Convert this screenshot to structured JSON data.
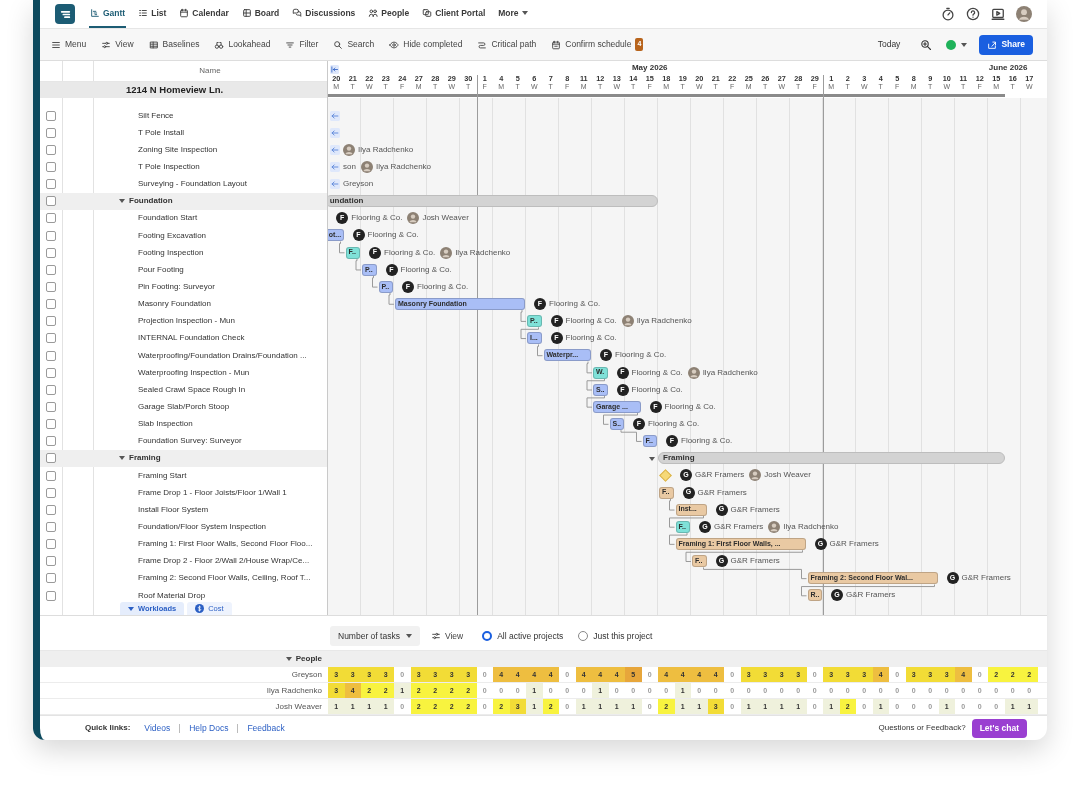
{
  "nav_tabs": [
    {
      "label": "Gantt",
      "selected": true
    },
    {
      "label": "List",
      "selected": false
    },
    {
      "label": "Calendar",
      "selected": false
    },
    {
      "label": "Board",
      "selected": false
    },
    {
      "label": "Discussions",
      "selected": false
    },
    {
      "label": "People",
      "selected": false
    },
    {
      "label": "Client Portal",
      "selected": false
    },
    {
      "label": "More",
      "selected": false
    }
  ],
  "toolbar": [
    {
      "label": "Menu"
    },
    {
      "label": "View"
    },
    {
      "label": "Baselines"
    },
    {
      "label": "Lookahead"
    },
    {
      "label": "Filter"
    },
    {
      "label": "Search"
    },
    {
      "label": "Hide completed"
    },
    {
      "label": "Critical path"
    },
    {
      "label": "Confirm schedule",
      "badge": "4"
    }
  ],
  "toolbar_right": {
    "today": "Today",
    "status": {
      "color": "#1fb25a"
    },
    "share": "Share"
  },
  "list_header": "Name",
  "project": "1214 N Homeview Ln.",
  "timeline": {
    "months": [
      {
        "days": [
          {
            "date": "20",
            "weekday": "M"
          },
          {
            "date": "21",
            "weekday": "T"
          },
          {
            "date": "22",
            "weekday": "W"
          },
          {
            "date": "23",
            "weekday": "T"
          },
          {
            "date": "24",
            "weekday": "F"
          },
          {
            "date": "27",
            "weekday": "M"
          },
          {
            "date": "28",
            "weekday": "T"
          },
          {
            "date": "29",
            "weekday": "W"
          },
          {
            "date": "30",
            "weekday": "T"
          }
        ]
      },
      {
        "label": "May 2026",
        "days": [
          {
            "date": "1",
            "weekday": "F"
          },
          {
            "date": "4",
            "weekday": "M"
          },
          {
            "date": "5",
            "weekday": "T"
          },
          {
            "date": "6",
            "weekday": "W"
          },
          {
            "date": "7",
            "weekday": "T"
          },
          {
            "date": "8",
            "weekday": "F"
          },
          {
            "date": "11",
            "weekday": "M"
          },
          {
            "date": "12",
            "weekday": "T"
          },
          {
            "date": "13",
            "weekday": "W"
          },
          {
            "date": "14",
            "weekday": "T"
          },
          {
            "date": "15",
            "weekday": "F"
          },
          {
            "date": "18",
            "weekday": "M"
          },
          {
            "date": "19",
            "weekday": "T"
          },
          {
            "date": "20",
            "weekday": "W"
          },
          {
            "date": "21",
            "weekday": "T"
          },
          {
            "date": "22",
            "weekday": "F"
          },
          {
            "date": "25",
            "weekday": "M"
          },
          {
            "date": "26",
            "weekday": "T"
          },
          {
            "date": "27",
            "weekday": "W"
          },
          {
            "date": "28",
            "weekday": "T"
          },
          {
            "date": "29",
            "weekday": "F"
          }
        ]
      },
      {
        "label": "June 2026",
        "days": [
          {
            "date": "1",
            "weekday": "M"
          },
          {
            "date": "2",
            "weekday": "T"
          },
          {
            "date": "3",
            "weekday": "W"
          },
          {
            "date": "4",
            "weekday": "T"
          },
          {
            "date": "5",
            "weekday": "F"
          },
          {
            "date": "8",
            "weekday": "M"
          },
          {
            "date": "9",
            "weekday": "T"
          },
          {
            "date": "10",
            "weekday": "W"
          },
          {
            "date": "11",
            "weekday": "T"
          },
          {
            "date": "12",
            "weekday": "F"
          },
          {
            "date": "15",
            "weekday": "M"
          },
          {
            "date": "16",
            "weekday": "T"
          },
          {
            "date": "17",
            "weekday": "W"
          }
        ]
      }
    ]
  },
  "tasks": [
    {
      "kind": "task",
      "name": "Silt Fence",
      "checked": false,
      "offscreen": true
    },
    {
      "kind": "task",
      "name": "T Pole Install",
      "checked": false,
      "offscreen": true
    },
    {
      "kind": "task",
      "name": "Zoning Site Inspection",
      "checked": false,
      "offscreen": true,
      "assignees": [
        {
          "kind": "person",
          "name": "Ilya Radchenko"
        }
      ]
    },
    {
      "kind": "task",
      "name": "T Pole Inspection",
      "checked": false,
      "offscreen": true,
      "assignees": [
        {
          "kind": "plain",
          "name": "son"
        },
        {
          "kind": "person",
          "name": "Ilya Radchenko"
        }
      ]
    },
    {
      "kind": "task",
      "name": "Surveying - Foundation Layout",
      "checked": false,
      "offscreen": true,
      "assignees": [
        {
          "kind": "plain",
          "name": "Greyson"
        }
      ]
    },
    {
      "kind": "group",
      "name": "Foundation",
      "checked": false,
      "expanded": true,
      "offscreen": false,
      "bar": {
        "kind": "group",
        "label": "undation"
      }
    },
    {
      "kind": "task",
      "name": "Foundation Start",
      "checked": false,
      "offscreen": false,
      "assignees": [
        {
          "kind": "company",
          "initial": "F",
          "name": "Flooring & Co."
        },
        {
          "kind": "person",
          "name": "Josh Weaver"
        }
      ]
    },
    {
      "kind": "task",
      "name": "Footing Excavation",
      "checked": false,
      "offscreen": false,
      "bar": {
        "kind": "bar",
        "label": "ot...",
        "color": "#a9bef6"
      },
      "assignees": [
        {
          "kind": "company",
          "initial": "F",
          "name": "Flooring & Co."
        }
      ]
    },
    {
      "kind": "task",
      "name": "Footing Inspection",
      "checked": false,
      "offscreen": false,
      "bar": {
        "kind": "bar",
        "label": "F..",
        "color": "#7fe1d8"
      },
      "assignees": [
        {
          "kind": "company",
          "initial": "F",
          "name": "Flooring & Co."
        },
        {
          "kind": "person",
          "name": "Ilya Radchenko"
        }
      ]
    },
    {
      "kind": "task",
      "name": "Pour Footing",
      "checked": false,
      "offscreen": false,
      "bar": {
        "kind": "bar",
        "label": "P..",
        "color": "#a9bef6"
      },
      "assignees": [
        {
          "kind": "company",
          "initial": "F",
          "name": "Flooring & Co."
        }
      ]
    },
    {
      "kind": "task",
      "name": "Pin Footing: Surveyor",
      "checked": false,
      "offscreen": false,
      "bar": {
        "kind": "bar",
        "label": "P..",
        "color": "#a9bef6"
      },
      "assignees": [
        {
          "kind": "company",
          "initial": "F",
          "name": "Flooring & Co."
        }
      ]
    },
    {
      "kind": "task",
      "name": "Masonry Foundation",
      "checked": false,
      "offscreen": false,
      "bar": {
        "kind": "bar",
        "label": "Masonry Foundation",
        "color": "#a9bef6"
      },
      "assignees": [
        {
          "kind": "company",
          "initial": "F",
          "name": "Flooring & Co."
        }
      ]
    },
    {
      "kind": "task",
      "name": "Projection Inspection - Mun",
      "checked": false,
      "offscreen": false,
      "bar": {
        "kind": "bar",
        "label": "P..",
        "color": "#7fe1d8"
      },
      "assignees": [
        {
          "kind": "company",
          "initial": "F",
          "name": "Flooring & Co."
        },
        {
          "kind": "person",
          "name": "Ilya Radchenko"
        }
      ]
    },
    {
      "kind": "task",
      "name": "INTERNAL Foundation Check",
      "checked": false,
      "offscreen": false,
      "bar": {
        "kind": "bar",
        "label": "I...",
        "color": "#a9bef6"
      },
      "assignees": [
        {
          "kind": "company",
          "initial": "F",
          "name": "Flooring & Co."
        }
      ]
    },
    {
      "kind": "task",
      "name": "Waterproofing/Foundation Drains/Foundation ...",
      "checked": false,
      "offscreen": false,
      "bar": {
        "kind": "bar",
        "label": "Waterpr...",
        "color": "#a9bef6"
      },
      "assignees": [
        {
          "kind": "company",
          "initial": "F",
          "name": "Flooring & Co."
        }
      ]
    },
    {
      "kind": "task",
      "name": "Waterproofing Inspection - Mun",
      "checked": false,
      "offscreen": false,
      "bar": {
        "kind": "bar",
        "label": "W.",
        "color": "#7fe1d8"
      },
      "assignees": [
        {
          "kind": "company",
          "initial": "F",
          "name": "Flooring & Co."
        },
        {
          "kind": "person",
          "name": "Ilya Radchenko"
        }
      ]
    },
    {
      "kind": "task",
      "name": "Sealed Crawl Space Rough In",
      "checked": false,
      "offscreen": false,
      "bar": {
        "kind": "bar",
        "label": "S..",
        "color": "#a9bef6"
      },
      "assignees": [
        {
          "kind": "company",
          "initial": "F",
          "name": "Flooring & Co."
        }
      ]
    },
    {
      "kind": "task",
      "name": "Garage Slab/Porch Stoop",
      "checked": false,
      "offscreen": false,
      "bar": {
        "kind": "bar",
        "label": "Garage ...",
        "color": "#a9bef6"
      },
      "assignees": [
        {
          "kind": "company",
          "initial": "F",
          "name": "Flooring & Co."
        }
      ]
    },
    {
      "kind": "task",
      "name": "Slab Inspection",
      "checked": false,
      "offscreen": false,
      "bar": {
        "kind": "bar",
        "label": "S..",
        "color": "#a9bef6"
      },
      "assignees": [
        {
          "kind": "company",
          "initial": "F",
          "name": "Flooring & Co."
        }
      ]
    },
    {
      "kind": "task",
      "name": "Foundation Survey: Surveyor",
      "checked": false,
      "offscreen": false,
      "bar": {
        "kind": "bar",
        "label": "F..",
        "color": "#a9bef6"
      },
      "assignees": [
        {
          "kind": "company",
          "initial": "F",
          "name": "Flooring & Co."
        }
      ]
    },
    {
      "kind": "group",
      "name": "Framing",
      "checked": false,
      "expanded": true,
      "offscreen": false,
      "bar": {
        "kind": "group",
        "label": "Framing"
      }
    },
    {
      "kind": "task",
      "name": "Framing Start",
      "checked": false,
      "offscreen": false,
      "bar": {
        "kind": "milestone"
      },
      "assignees": [
        {
          "kind": "company",
          "initial": "G",
          "name": "G&R Framers"
        },
        {
          "kind": "person",
          "name": "Josh Weaver"
        }
      ]
    },
    {
      "kind": "task",
      "name": "Frame Drop 1 - Floor Joists/Floor 1/Wall 1",
      "checked": false,
      "offscreen": false,
      "bar": {
        "kind": "bar",
        "label": "F..",
        "color": "#e9c9a3"
      },
      "assignees": [
        {
          "kind": "company",
          "initial": "G",
          "name": "G&R Framers"
        }
      ]
    },
    {
      "kind": "task",
      "name": "Install Floor System",
      "checked": false,
      "offscreen": false,
      "bar": {
        "kind": "bar",
        "label": "Inst...",
        "color": "#e9c9a3"
      },
      "assignees": [
        {
          "kind": "company",
          "initial": "G",
          "name": "G&R Framers"
        }
      ]
    },
    {
      "kind": "task",
      "name": "Foundation/Floor System Inspection",
      "checked": false,
      "offscreen": false,
      "bar": {
        "kind": "bar",
        "label": "F..",
        "color": "#7fe1d8"
      },
      "assignees": [
        {
          "kind": "company",
          "initial": "G",
          "name": "G&R Framers"
        },
        {
          "kind": "person",
          "name": "Ilya Radchenko"
        }
      ]
    },
    {
      "kind": "task",
      "name": "Framing 1: First Floor Walls, Second Floor Floo...",
      "checked": false,
      "offscreen": false,
      "bar": {
        "kind": "bar",
        "label": "Framing 1: First Floor Walls, ...",
        "color": "#e9c9a3"
      },
      "assignees": [
        {
          "kind": "company",
          "initial": "G",
          "name": "G&R Framers"
        }
      ]
    },
    {
      "kind": "task",
      "name": "Frame Drop 2 - Floor 2/Wall 2/House Wrap/Ce...",
      "checked": false,
      "offscreen": false,
      "bar": {
        "kind": "bar",
        "label": "F..",
        "color": "#e9c9a3"
      },
      "assignees": [
        {
          "kind": "company",
          "initial": "G",
          "name": "G&R Framers"
        }
      ]
    },
    {
      "kind": "task",
      "name": "Framing 2: Second Floor Walls, Ceiling, Roof T...",
      "checked": false,
      "offscreen": false,
      "bar": {
        "kind": "bar",
        "label": "Framing 2: Second Floor Wal...",
        "color": "#e9c9a3"
      },
      "assignees": [
        {
          "kind": "company",
          "initial": "G",
          "name": "G&R Framers"
        }
      ]
    },
    {
      "kind": "task",
      "name": "Roof Material Drop",
      "checked": false,
      "offscreen": false,
      "bar": {
        "kind": "bar",
        "label": "R..",
        "color": "#e9c9a3"
      },
      "assignees": [
        {
          "kind": "company",
          "initial": "G",
          "name": "G&R Framers"
        }
      ]
    }
  ],
  "workload": {
    "tabs": [
      {
        "label": "Workloads",
        "selected": true
      },
      {
        "label": "Cost",
        "selected": false
      }
    ],
    "metric": "Number of tasks",
    "view": "View",
    "scope": [
      {
        "label": "All active projects",
        "selected": true
      },
      {
        "label": "Just this project",
        "selected": false
      }
    ],
    "group": {
      "label": "People",
      "expanded": true
    },
    "rows": [
      {
        "name": "Greyson",
        "cells": [
          "3",
          "3",
          "3",
          "3",
          "0",
          "3",
          "3",
          "3",
          "3",
          "0",
          "4",
          "4",
          "4",
          "4",
          "0",
          "4",
          "4",
          "4",
          "5",
          "0",
          "4",
          "4",
          "4",
          "4",
          "0",
          "3",
          "3",
          "3",
          "3",
          "0",
          "3",
          "3",
          "3",
          "4",
          "0",
          "3",
          "3",
          "3",
          "4",
          "0",
          "2",
          "2",
          "2"
        ]
      },
      {
        "name": "Ilya Radchenko",
        "cells": [
          "3",
          "4",
          "2",
          "2",
          "1",
          "2",
          "2",
          "2",
          "2",
          "0",
          "0",
          "0",
          "1",
          "0",
          "0",
          "0",
          "1",
          "0",
          "0",
          "0",
          "0",
          "1",
          "0",
          "0",
          "0",
          "0",
          "0",
          "0",
          "0",
          "0",
          "0",
          "0",
          "0",
          "0",
          "0",
          "0",
          "0",
          "0",
          "0",
          "0",
          "0",
          "0",
          "0"
        ]
      },
      {
        "name": "Josh Weaver",
        "cells": [
          "1",
          "1",
          "1",
          "1",
          "0",
          "2",
          "2",
          "2",
          "2",
          "0",
          "2",
          "3",
          "1",
          "2",
          "0",
          "1",
          "1",
          "1",
          "1",
          "0",
          "2",
          "1",
          "1",
          "3",
          "0",
          "1",
          "1",
          "1",
          "1",
          "0",
          "1",
          "2",
          "0",
          "1",
          "0",
          "0",
          "0",
          "1",
          "0",
          "0",
          "0",
          "1",
          "1"
        ]
      }
    ]
  },
  "footer": {
    "label": "Quick links:",
    "links": [
      "Videos",
      "Help Docs",
      "Feedback"
    ],
    "question": "Questions or Feedback?",
    "chat": "Let's chat"
  }
}
